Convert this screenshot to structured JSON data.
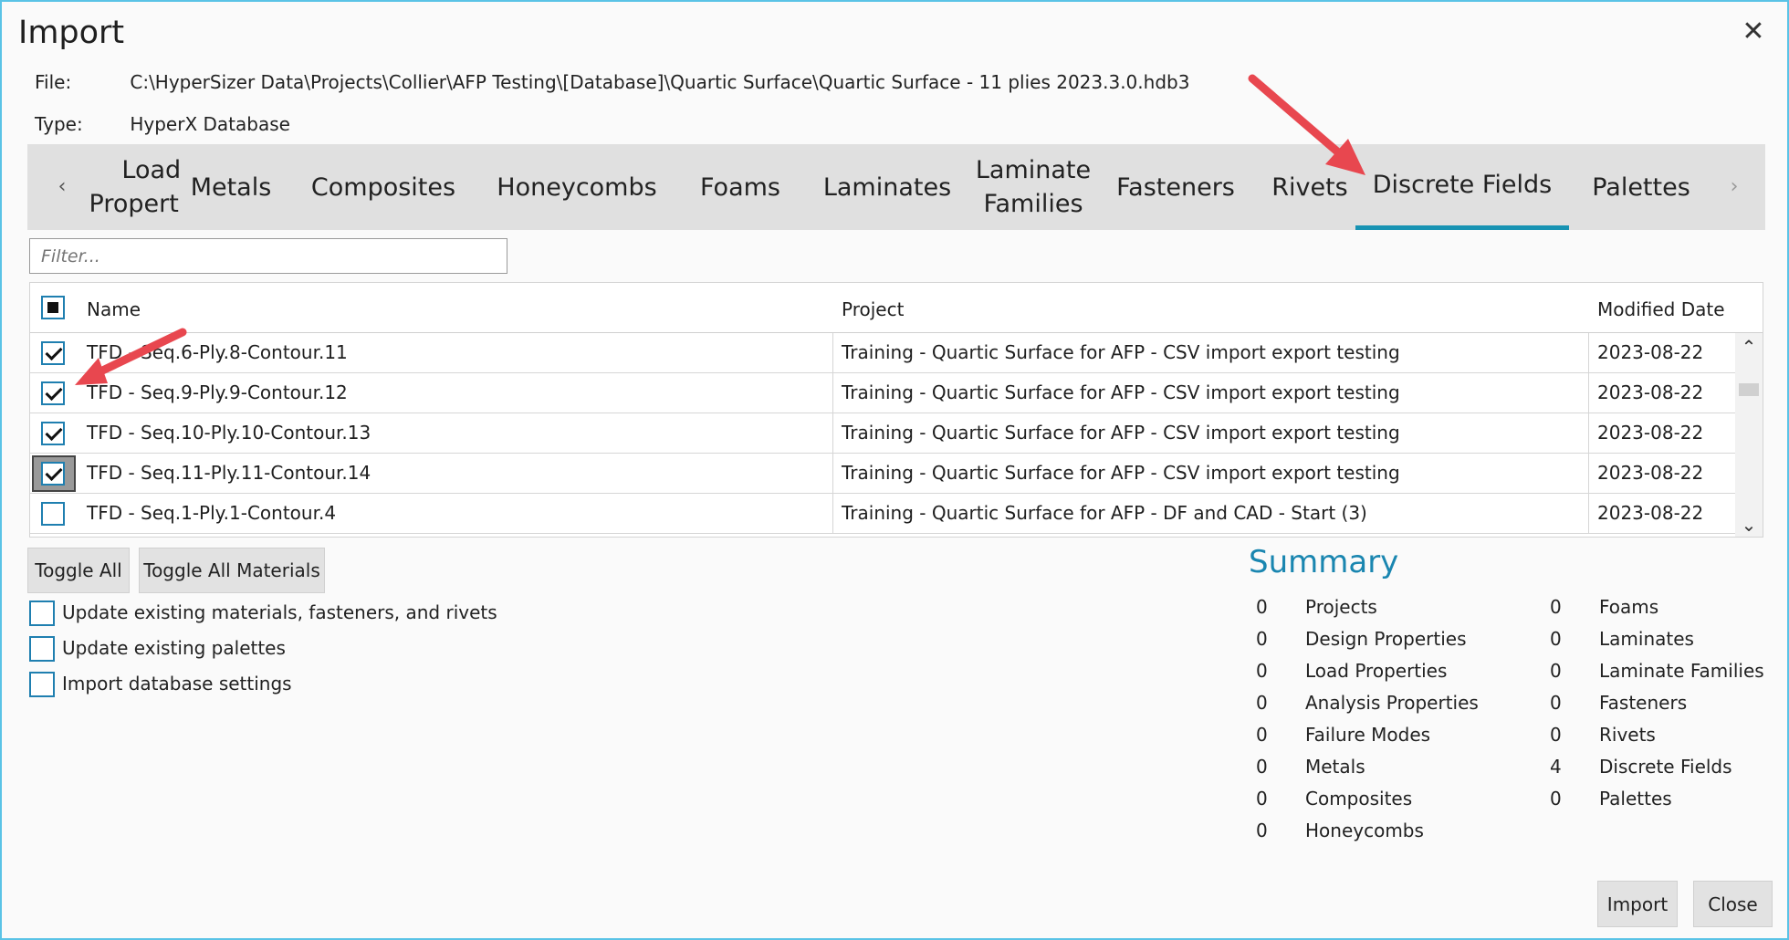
{
  "window": {
    "title": "Import",
    "close_glyph": "✕"
  },
  "info": {
    "file_label": "File:",
    "file_value": "C:\\HyperSizer Data\\Projects\\Collier\\AFP Testing\\[Database]\\Quartic Surface\\Quartic Surface - 11 plies 2023.3.0.hdb3",
    "type_label": "Type:",
    "type_value": "HyperX Database"
  },
  "tabs": {
    "left_arrow": "‹",
    "right_arrow": "›",
    "items": [
      {
        "label": "Load Properties",
        "line1": "Load",
        "line2": "Properties",
        "clipped": true
      },
      {
        "label": "Metals"
      },
      {
        "label": "Composites"
      },
      {
        "label": "Honeycombs"
      },
      {
        "label": "Foams"
      },
      {
        "label": "Laminates"
      },
      {
        "label": "Laminate Families",
        "line1": "Laminate",
        "line2": "Families"
      },
      {
        "label": "Fasteners"
      },
      {
        "label": "Rivets"
      },
      {
        "label": "Discrete Fields",
        "active": true
      },
      {
        "label": "Palettes"
      }
    ],
    "active_tab": "Discrete Fields"
  },
  "filter": {
    "placeholder": "Filter..."
  },
  "grid": {
    "columns": [
      "Name",
      "Project",
      "Modified Date"
    ],
    "header_select_all": "partial",
    "rows": [
      {
        "checked": true,
        "name": "TFD - Seq.6-Ply.8-Contour.11",
        "project": "Training - Quartic Surface for AFP - CSV import export testing",
        "date": "2023-08-22"
      },
      {
        "checked": true,
        "name": "TFD - Seq.9-Ply.9-Contour.12",
        "project": "Training - Quartic Surface for AFP - CSV import export testing",
        "date": "2023-08-22"
      },
      {
        "checked": true,
        "name": "TFD - Seq.10-Ply.10-Contour.13",
        "project": "Training - Quartic Surface for AFP - CSV import export testing",
        "date": "2023-08-22"
      },
      {
        "checked": true,
        "focused": true,
        "name": "TFD - Seq.11-Ply.11-Contour.14",
        "project": "Training - Quartic Surface for AFP - CSV import export testing",
        "date": "2023-08-22"
      },
      {
        "checked": false,
        "name": "TFD - Seq.1-Ply.1-Contour.4",
        "project": "Training - Quartic Surface for AFP - DF and CAD - Start (3)",
        "date": "2023-08-22"
      }
    ],
    "scroll_up": "⌃",
    "scroll_down": "⌄"
  },
  "buttons": {
    "toggle_all": "Toggle All",
    "toggle_all_materials": "Toggle All Materials",
    "import": "Import",
    "close": "Close"
  },
  "options": [
    {
      "label": "Update existing materials, fasteners, and rivets",
      "checked": false
    },
    {
      "label": "Update existing palettes",
      "checked": false
    },
    {
      "label": "Import database settings",
      "checked": false
    }
  ],
  "summary": {
    "title": "Summary",
    "left": [
      {
        "count": "0",
        "label": "Projects"
      },
      {
        "count": "0",
        "label": "Design Properties"
      },
      {
        "count": "0",
        "label": "Load Properties"
      },
      {
        "count": "0",
        "label": "Analysis Properties"
      },
      {
        "count": "0",
        "label": "Failure Modes"
      },
      {
        "count": "0",
        "label": "Metals"
      },
      {
        "count": "0",
        "label": "Composites"
      },
      {
        "count": "0",
        "label": "Honeycombs"
      }
    ],
    "right": [
      {
        "count": "0",
        "label": "Foams"
      },
      {
        "count": "0",
        "label": "Laminates"
      },
      {
        "count": "0",
        "label": "Laminate Families"
      },
      {
        "count": "0",
        "label": "Fasteners"
      },
      {
        "count": "0",
        "label": "Rivets"
      },
      {
        "count": "4",
        "label": "Discrete Fields"
      },
      {
        "count": "0",
        "label": "Palettes"
      }
    ]
  },
  "colors": {
    "accent": "#1893b3",
    "checkbox_border": "#1f7fb0",
    "summary_title": "#1a86b0",
    "annotation_arrow": "#e8474f",
    "window_border": "#5ac3e6"
  }
}
